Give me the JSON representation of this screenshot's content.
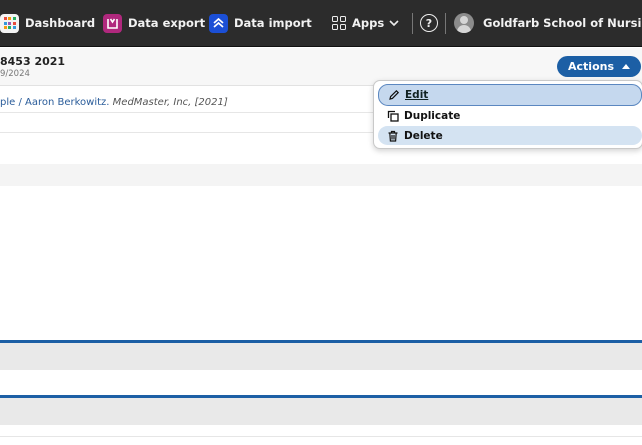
{
  "nav": {
    "dashboard": "Dashboard",
    "data_export": "Data export",
    "data_import": "Data import",
    "apps": "Apps",
    "help": "?",
    "organization": "Goldfarb School of Nursing",
    "icons": {
      "dashboard": "dashboard-grid-icon",
      "data_export": "data-export-icon",
      "data_import": "data-import-icon",
      "apps": "apps-grid-icon",
      "help": "help-circle-icon",
      "user": "user-avatar-icon"
    },
    "dashboard_icon_colors": [
      "#e74c3c",
      "#f39c12",
      "#27ae60",
      "#3498db",
      "#9b59b6",
      "#e74c3c",
      "#f39c12",
      "#27ae60",
      "#3498db"
    ],
    "export_color": "#b0287d",
    "import_color": "#1b4fd6"
  },
  "record": {
    "title": "8453 2021",
    "date": "9/2024",
    "citation_author": "ple / Aaron Berkowitz.",
    "citation_publisher": "MedMaster, Inc, [2021]"
  },
  "actions": {
    "label": "Actions",
    "accent_color": "#1c5fa5"
  },
  "menu": {
    "edit": "Edit",
    "duplicate": "Duplicate",
    "delete": "Delete",
    "icons": [
      "pencil-icon",
      "duplicate-icon",
      "trash-icon"
    ]
  }
}
